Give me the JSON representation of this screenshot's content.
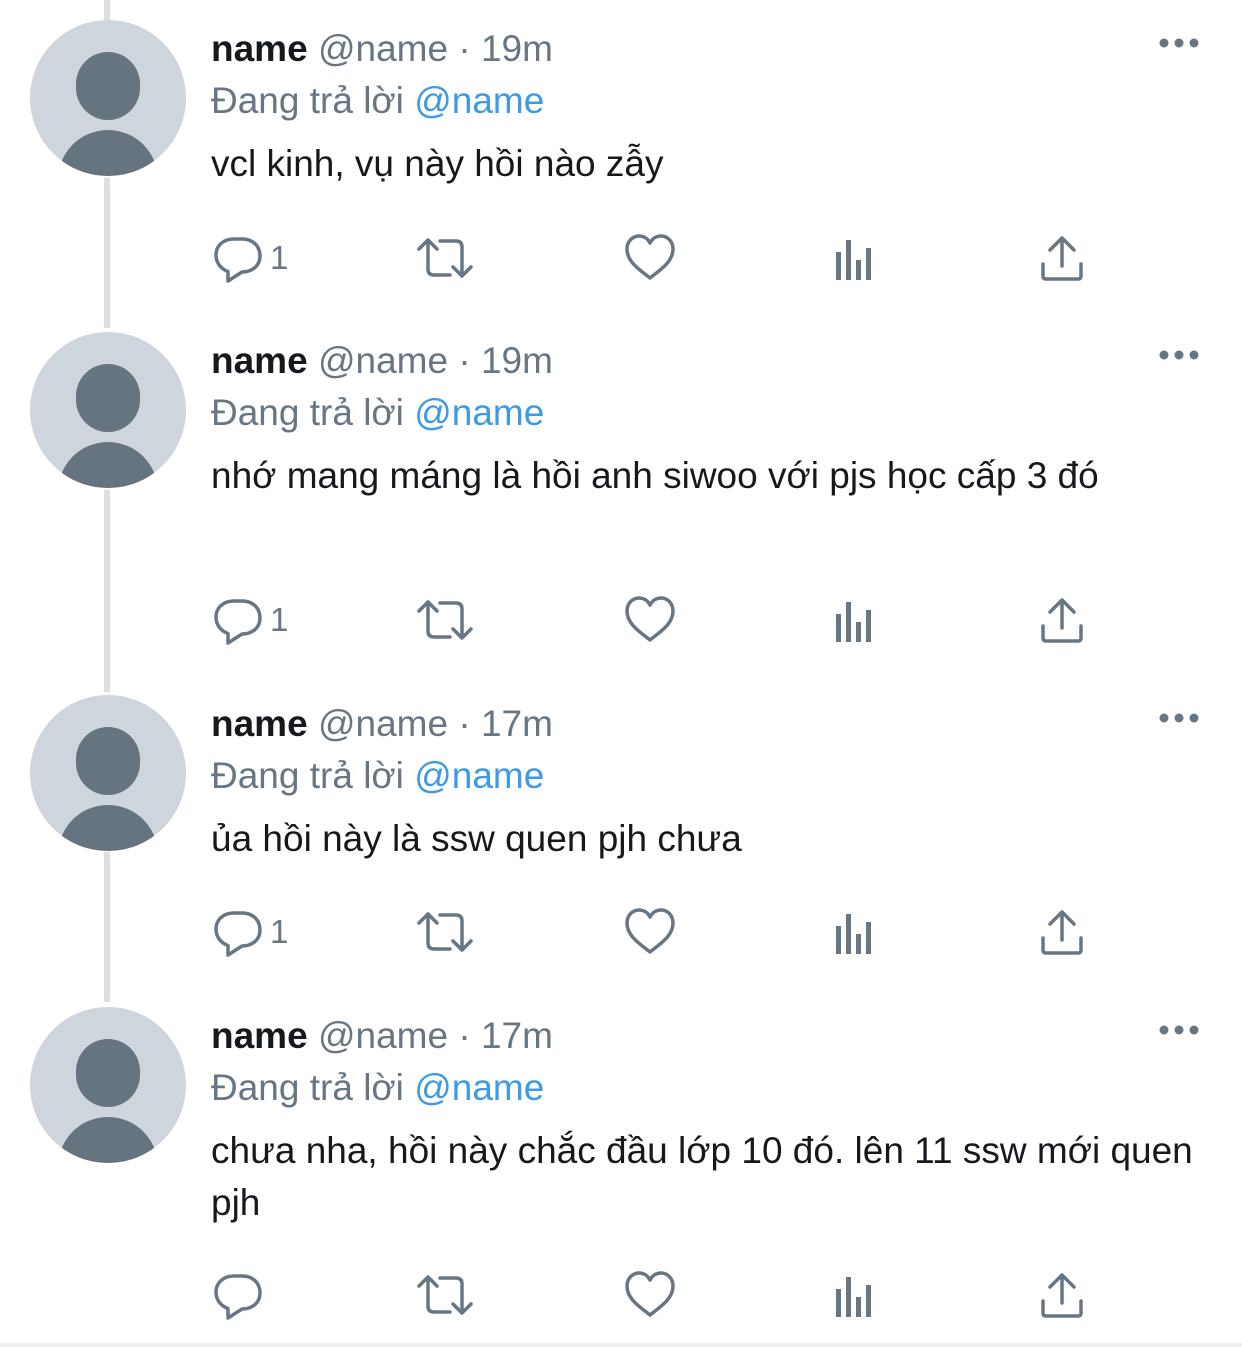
{
  "tweets": [
    {
      "name": "name",
      "handle": "@name",
      "separator": "·",
      "time": "19m",
      "reply_prefix": "Đang trả lời",
      "reply_to": "@name",
      "text": "vcl kinh, vụ này hồi nào zẫy",
      "reply_count": "1"
    },
    {
      "name": "name",
      "handle": "@name",
      "separator": "·",
      "time": "19m",
      "reply_prefix": "Đang trả lời",
      "reply_to": "@name",
      "text": "nhớ mang máng là hồi anh siwoo với pjs học cấp 3 đó",
      "reply_count": "1"
    },
    {
      "name": "name",
      "handle": "@name",
      "separator": "·",
      "time": "17m",
      "reply_prefix": "Đang trả lời",
      "reply_to": "@name",
      "text": "ủa hồi này là ssw quen pjh chưa",
      "reply_count": "1"
    },
    {
      "name": "name",
      "handle": "@name",
      "separator": "·",
      "time": "17m",
      "reply_prefix": "Đang trả lời",
      "reply_to": "@name",
      "text": "chưa nha, hồi này chắc đầu lớp 10 đó. lên 11 ssw mới quen pjh",
      "reply_count": ""
    }
  ],
  "icons": {
    "reply": "reply-icon",
    "retweet": "retweet-icon",
    "like": "heart-icon",
    "analytics": "analytics-icon",
    "share": "share-icon",
    "more": "more-icon",
    "avatar": "default-avatar"
  },
  "colors": {
    "text": "#15181c",
    "secondary": "#687684",
    "mention": "#3d9ae6",
    "thread_line": "#dcdfe3",
    "avatar_bg": "#ced5dd",
    "avatar_fg": "#66747f"
  }
}
